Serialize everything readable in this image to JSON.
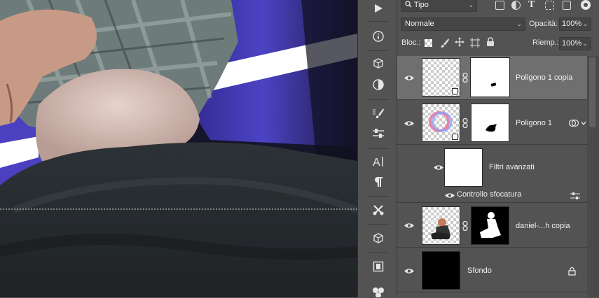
{
  "filter": {
    "kind_label": "Tipo"
  },
  "blend": {
    "mode": "Normale",
    "opacity_label": "Opacità:",
    "opacity_value": "100%"
  },
  "lock": {
    "label": "Bloc.:",
    "fill_label": "Riemp.:",
    "fill_value": "100%"
  },
  "layers": [
    {
      "name": "Poligono 1 copia",
      "active": true
    },
    {
      "name": "Poligono 1",
      "active": false
    },
    {
      "name": "Filtri avanzati",
      "active": false
    },
    {
      "name": "Controllo sfocatura",
      "active": false
    },
    {
      "name": "daniel-...h copia",
      "active": false
    },
    {
      "name": "Sfondo",
      "active": false
    }
  ],
  "colors": {
    "panel": "#535353",
    "active_row": "#6f6f6f",
    "accent": "#5a4fd0"
  }
}
